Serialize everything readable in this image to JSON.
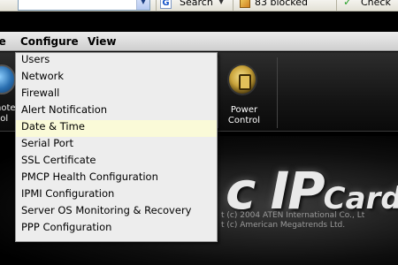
{
  "browser_toolbar": {
    "search_label": "Search",
    "blocked_label": "83 blocked",
    "check_label": "Check"
  },
  "menubar": {
    "cut_label": "ge",
    "configure_label": "Configure",
    "view_label": "View"
  },
  "configure_menu": {
    "highlighted_index": 4,
    "items": [
      "Users",
      "Network",
      "Firewall",
      "Alert Notification",
      "Date & Time",
      "Serial Port",
      "SSL Certificate",
      "PMCP Health Configuration",
      "IPMI Configuration",
      "Server OS Monitoring & Recovery",
      "PPP Configuration"
    ]
  },
  "toolbar_icons": {
    "remote_label_line1": "note",
    "remote_label_line2": "sol",
    "power_label_line1": "Power",
    "power_label_line2": "Control"
  },
  "logo": {
    "text_main": "c IP",
    "text_small": "Card"
  },
  "copyright": {
    "line1": "t (c) 2004 ATEN International Co., Lt",
    "line2": "t (c) American Megatrends Ltd."
  },
  "colors": {
    "menu_highlight": "#fafad8",
    "menu_background": "#ededed",
    "app_background": "#000000"
  }
}
